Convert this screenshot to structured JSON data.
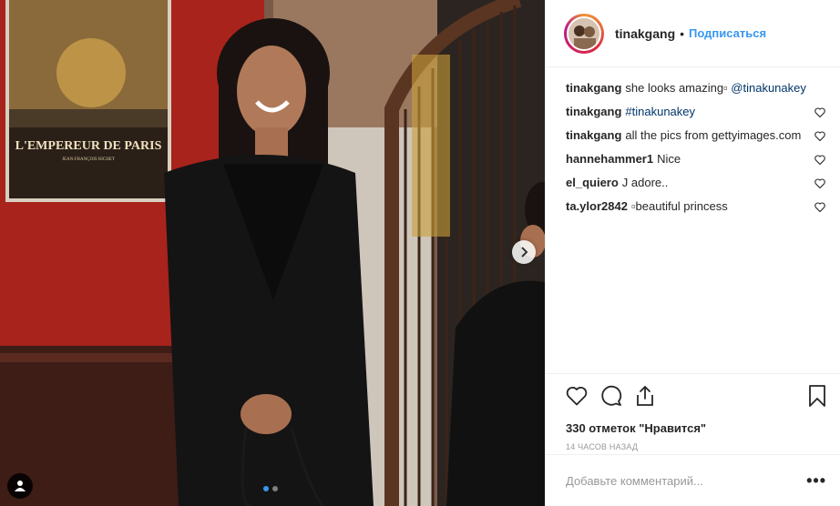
{
  "post": {
    "poster": {
      "title_line1": "L'EMPEREUR DE PARIS",
      "subtitle": "JEAN-FRANÇOIS RICHET"
    },
    "carousel": {
      "total": 2,
      "active": 1
    },
    "icons": {
      "tag": "person-tag-icon",
      "next": "chevron-right-icon"
    }
  },
  "header": {
    "username": "tinakgang",
    "separator": "•",
    "follow_label": "Подписаться"
  },
  "comments": [
    {
      "user": "tinakgang",
      "text": "she looks amazing▫ ",
      "link": "@tinakunakey",
      "heart": false
    },
    {
      "user": "tinakgang",
      "text": "",
      "link": "#tinakunakey",
      "heart": true
    },
    {
      "user": "tinakgang",
      "text": "all the pics from gettyimages.com",
      "link": "",
      "heart": true
    },
    {
      "user": "hannehammer1",
      "text": "Nice",
      "link": "",
      "heart": true
    },
    {
      "user": "el_quiero",
      "text": "J adore..",
      "link": "",
      "heart": true
    },
    {
      "user": "ta.ylor2842",
      "text": "▫beautiful princess",
      "link": "",
      "heart": true
    }
  ],
  "actions": {
    "likes_text": "330 отметок \"Нравится\"",
    "time_text": "14 часов назад"
  },
  "add_comment": {
    "placeholder": "Добавьте комментарий...",
    "more_label": "•••"
  }
}
